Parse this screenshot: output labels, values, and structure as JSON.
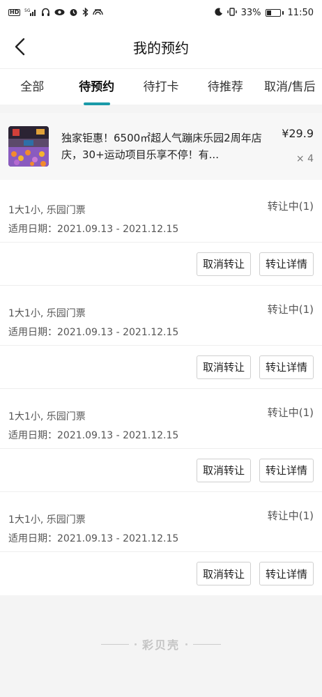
{
  "status_bar": {
    "left_icons": [
      "HD",
      "5G",
      "signal-icon",
      "headphones-icon",
      "eye-icon",
      "alarm-icon",
      "bluetooth-icon",
      "cast-icon"
    ],
    "battery_percent": "33%",
    "time": "11:50"
  },
  "nav": {
    "title": "我的预约"
  },
  "tabs": [
    {
      "label": "全部",
      "active": false
    },
    {
      "label": "待预约",
      "active": true
    },
    {
      "label": "待打卡",
      "active": false
    },
    {
      "label": "待推荐",
      "active": false
    },
    {
      "label": "取消/售后",
      "active": false
    }
  ],
  "product": {
    "title": "独家钜惠！6500㎡超人气蹦床乐园2周年店庆，30+运动项目乐享不停！有...",
    "price": "¥29.9",
    "qty": "× 4"
  },
  "transfers": [
    {
      "ticket": "1大1小, 乐园门票",
      "valid": "适用日期：2021.09.13 - 2021.12.15",
      "status": "转让中(1)",
      "cancel_label": "取消转让",
      "detail_label": "转让详情"
    },
    {
      "ticket": "1大1小, 乐园门票",
      "valid": "适用日期：2021.09.13 - 2021.12.15",
      "status": "转让中(1)",
      "cancel_label": "取消转让",
      "detail_label": "转让详情"
    },
    {
      "ticket": "1大1小, 乐园门票",
      "valid": "适用日期：2021.09.13 - 2021.12.15",
      "status": "转让中(1)",
      "cancel_label": "取消转让",
      "detail_label": "转让详情"
    },
    {
      "ticket": "1大1小, 乐园门票",
      "valid": "适用日期：2021.09.13 - 2021.12.15",
      "status": "转让中(1)",
      "cancel_label": "取消转让",
      "detail_label": "转让详情"
    }
  ],
  "footer": {
    "brand": "彩贝壳"
  },
  "colors": {
    "accent": "#1a9aa8"
  }
}
